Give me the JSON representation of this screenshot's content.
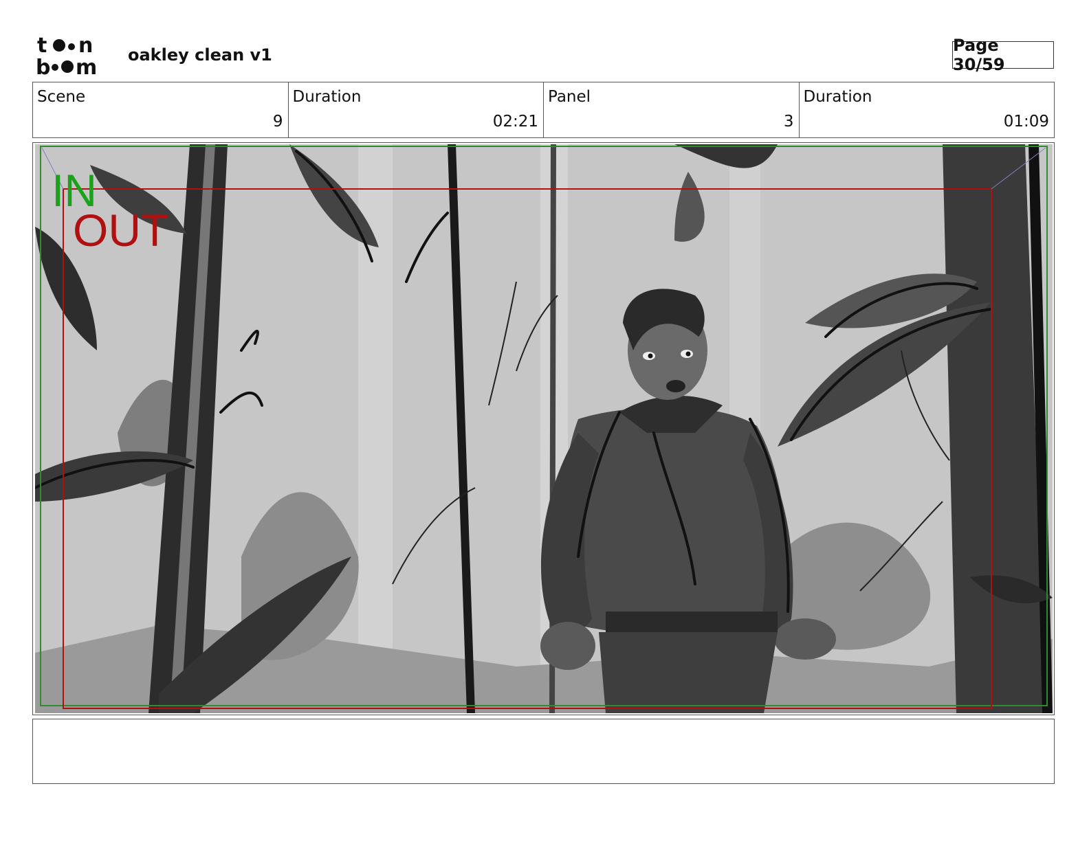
{
  "header": {
    "logo_text": "toon boom",
    "project_title": "oakley clean v1",
    "page_label": "Page 30/59"
  },
  "info": [
    {
      "label": "Scene",
      "value": "9"
    },
    {
      "label": "Duration",
      "value": "02:21"
    },
    {
      "label": "Panel",
      "value": "3"
    },
    {
      "label": "Duration",
      "value": "01:09"
    }
  ],
  "panel": {
    "in_label": "IN",
    "out_label": "OUT",
    "colors": {
      "in": "#1aa31a",
      "out": "#b01010",
      "safe_frame": "#2e8b2e",
      "action_frame": "#b01010",
      "bg": "#c4c4c4"
    }
  },
  "notes": {
    "text": ""
  }
}
